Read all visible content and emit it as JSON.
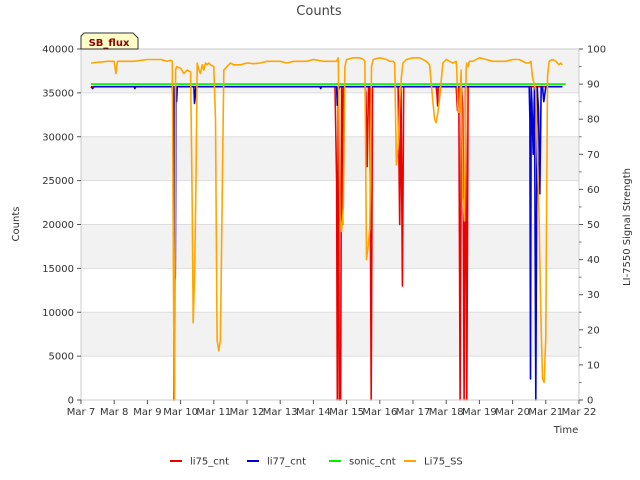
{
  "chart_data": {
    "type": "line",
    "title": "Counts",
    "badge": "SB_flux",
    "xlabel": "Time",
    "ylabel": "Counts",
    "y2label": "LI-7550 Signal Strength",
    "xlim": [
      7,
      22
    ],
    "ylim": [
      0,
      40000
    ],
    "y2lim": [
      0,
      100
    ],
    "x_ticks": [
      7,
      8,
      9,
      10,
      11,
      12,
      13,
      14,
      15,
      16,
      17,
      18,
      19,
      20,
      21,
      22
    ],
    "x_tick_labels": [
      "Mar 7",
      "Mar 8",
      "Mar 9",
      "Mar 10",
      "Mar 11",
      "Mar 12",
      "Mar 13",
      "Mar 14",
      "Mar 15",
      "Mar 16",
      "Mar 17",
      "Mar 18",
      "Mar 19",
      "Mar 20",
      "Mar 21",
      "Mar 22"
    ],
    "y_ticks": [
      0,
      5000,
      10000,
      15000,
      20000,
      25000,
      30000,
      35000,
      40000
    ],
    "y2_ticks": [
      0,
      10,
      20,
      30,
      40,
      50,
      60,
      70,
      80,
      90,
      100
    ],
    "grid": "horizontal bands",
    "legend_position": "bottom",
    "series": [
      {
        "name": "li75_cnt",
        "color": "#ee0000",
        "axis": "left",
        "x": [
          7.3,
          9.75,
          9.78,
          9.8,
          9.82,
          9.84,
          9.86,
          14.65,
          14.7,
          14.72,
          14.75,
          14.78,
          14.82,
          14.85,
          14.88,
          14.9,
          15.55,
          15.58,
          15.62,
          15.66,
          15.7,
          15.74,
          15.78,
          16.55,
          16.6,
          16.64,
          16.68,
          16.72,
          16.76,
          16.8,
          17.7,
          17.72,
          17.74,
          17.76,
          18.3,
          18.34,
          18.38,
          18.42,
          18.46,
          18.5,
          18.54,
          18.58,
          18.62,
          18.66,
          21.5
        ],
        "values": [
          35700,
          35700,
          33800,
          0,
          2000,
          34000,
          35700,
          35700,
          25000,
          0,
          35700,
          0,
          0,
          35700,
          20000,
          35700,
          35700,
          35000,
          26600,
          35700,
          35500,
          0,
          35700,
          35700,
          20000,
          35700,
          13000,
          35700,
          35700,
          35700,
          35700,
          35000,
          33500,
          35700,
          35700,
          33000,
          35700,
          0,
          35700,
          33200,
          0,
          35700,
          0,
          35700,
          35700
        ]
      },
      {
        "name": "li77_cnt",
        "color": "#0000dd",
        "axis": "left",
        "x": [
          7.3,
          7.35,
          7.4,
          8.6,
          8.62,
          8.65,
          9.8,
          9.82,
          9.84,
          9.86,
          9.88,
          9.9,
          10.4,
          10.42,
          10.44,
          10.46,
          10.48,
          14.2,
          14.22,
          14.24,
          14.7,
          14.72,
          14.75,
          14.78,
          20.5,
          20.52,
          20.54,
          20.56,
          20.58,
          20.62,
          20.66,
          20.7,
          20.74,
          20.78,
          20.82,
          20.86,
          20.9,
          20.94,
          21.0,
          21.5
        ],
        "values": [
          35700,
          35500,
          35700,
          35700,
          35500,
          35700,
          35700,
          13500,
          14000,
          35000,
          34000,
          35700,
          35700,
          33800,
          34500,
          35700,
          35700,
          35700,
          35500,
          35700,
          35700,
          33600,
          35000,
          35700,
          35700,
          32000,
          2400,
          35700,
          34000,
          28000,
          35700,
          0,
          35700,
          33000,
          23500,
          35700,
          35700,
          34000,
          35700,
          35700
        ]
      },
      {
        "name": "sonic_cnt",
        "color": "#00ee00",
        "axis": "left",
        "x": [
          7.3,
          21.6
        ],
        "values": [
          36000,
          36000
        ]
      },
      {
        "name": "Li75_SS",
        "color": "#ffa500",
        "axis": "right",
        "x": [
          7.3,
          7.8,
          8.0,
          8.05,
          8.1,
          8.2,
          8.6,
          9.0,
          9.4,
          9.6,
          9.7,
          9.75,
          9.8,
          9.82,
          9.85,
          9.88,
          10.0,
          10.1,
          10.2,
          10.3,
          10.35,
          10.38,
          10.42,
          10.46,
          10.5,
          10.55,
          10.6,
          10.65,
          10.7,
          10.75,
          10.8,
          10.85,
          10.9,
          11.0,
          11.05,
          11.1,
          11.15,
          11.2,
          11.3,
          11.4,
          11.5,
          11.6,
          11.8,
          12.0,
          12.2,
          12.4,
          12.6,
          12.8,
          13.0,
          13.2,
          13.4,
          13.6,
          13.8,
          14.0,
          14.3,
          14.6,
          14.7,
          14.75,
          14.8,
          14.85,
          14.9,
          14.95,
          15.0,
          15.2,
          15.4,
          15.5,
          15.55,
          15.6,
          15.65,
          15.7,
          15.75,
          15.8,
          16.0,
          16.2,
          16.3,
          16.4,
          16.45,
          16.5,
          16.55,
          16.6,
          16.65,
          16.7,
          16.8,
          17.0,
          17.2,
          17.4,
          17.5,
          17.6,
          17.65,
          17.7,
          17.75,
          17.8,
          17.9,
          18.0,
          18.1,
          18.2,
          18.3,
          18.32,
          18.36,
          18.4,
          18.45,
          18.5,
          18.55,
          18.6,
          18.62,
          18.66,
          18.7,
          18.8,
          19.0,
          19.2,
          19.4,
          19.6,
          19.8,
          20.0,
          20.2,
          20.4,
          20.5,
          20.55,
          20.6,
          20.7,
          20.8,
          20.85,
          20.9,
          20.95,
          21.0,
          21.05,
          21.1,
          21.2,
          21.3,
          21.4,
          21.45,
          21.5
        ],
        "values": [
          96,
          96.5,
          96.5,
          93,
          96.5,
          96.5,
          96.5,
          97,
          97,
          96.5,
          96.8,
          96.5,
          10,
          0,
          94,
          95,
          94.5,
          93,
          94,
          93.5,
          56,
          22,
          35,
          60,
          96,
          94,
          93,
          95.5,
          94,
          96,
          95.5,
          96,
          95.5,
          95,
          80,
          17,
          14,
          17,
          94,
          95,
          96,
          95.5,
          95.5,
          96,
          95.8,
          96,
          96.5,
          96.5,
          96.5,
          96,
          96.5,
          96.5,
          96.5,
          97,
          96.5,
          96.5,
          96.5,
          97.5,
          52,
          48,
          55,
          95,
          97,
          97.5,
          97.5,
          97,
          96.5,
          40,
          44,
          49,
          95,
          97,
          97.5,
          97,
          96.5,
          96.5,
          96,
          67,
          72,
          85,
          92,
          96,
          97,
          97.5,
          97.5,
          96.5,
          95.5,
          85,
          80,
          79,
          82,
          86,
          96,
          97,
          96.5,
          96,
          96.5,
          94,
          82,
          82,
          94,
          58,
          51,
          94,
          96,
          95,
          96.5,
          96.5,
          97.5,
          97,
          96.5,
          96.5,
          96.5,
          97,
          97,
          96,
          96,
          96.5,
          92,
          88,
          50,
          25,
          6,
          5,
          18,
          92,
          96.5,
          97,
          96.5,
          95.5,
          96,
          95.5
        ]
      }
    ]
  }
}
